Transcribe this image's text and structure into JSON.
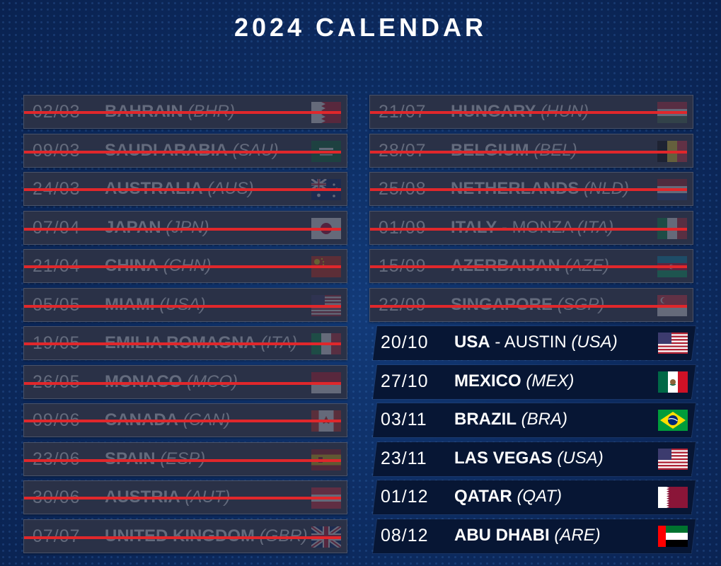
{
  "title": "2024 CALENDAR",
  "left_column": [
    {
      "date": "02/03",
      "country": "BAHRAIN",
      "circuit": "",
      "code": "(BHR)",
      "flag": "bahrain-flag",
      "status": "past"
    },
    {
      "date": "09/03",
      "country": "SAUDI ARABIA",
      "circuit": "",
      "code": "(SAU)",
      "flag": "saudi-arabia-flag",
      "status": "past"
    },
    {
      "date": "24/03",
      "country": "AUSTRALIA",
      "circuit": "",
      "code": "(AUS)",
      "flag": "australia-flag",
      "status": "past"
    },
    {
      "date": "07/04",
      "country": "JAPAN",
      "circuit": "",
      "code": "(JPN)",
      "flag": "japan-flag",
      "status": "past"
    },
    {
      "date": "21/04",
      "country": "CHINA",
      "circuit": "",
      "code": "(CHN)",
      "flag": "china-flag",
      "status": "past"
    },
    {
      "date": "05/05",
      "country": "MIAMI",
      "circuit": "",
      "code": "(USA)",
      "flag": "usa-flag",
      "status": "past"
    },
    {
      "date": "19/05",
      "country": "EMILIA ROMAGNA",
      "circuit": "",
      "code": "(ITA)",
      "flag": "italy-flag",
      "status": "past"
    },
    {
      "date": "26/05",
      "country": "MONACO",
      "circuit": "",
      "code": "(MCO)",
      "flag": "monaco-flag",
      "status": "past"
    },
    {
      "date": "09/06",
      "country": "CANADA",
      "circuit": "",
      "code": "(CAN)",
      "flag": "canada-flag",
      "status": "past"
    },
    {
      "date": "23/06",
      "country": "SPAIN",
      "circuit": "",
      "code": "(ESP)",
      "flag": "spain-flag",
      "status": "past"
    },
    {
      "date": "30/06",
      "country": "AUSTRIA",
      "circuit": "",
      "code": "(AUT)",
      "flag": "austria-flag",
      "status": "past"
    },
    {
      "date": "07/07",
      "country": "UNITED KINGDOM",
      "circuit": "",
      "code": "(GBR)",
      "flag": "uk-flag",
      "status": "past"
    }
  ],
  "right_column": [
    {
      "date": "21/07",
      "country": "HUNGARY",
      "circuit": "",
      "code": "(HUN)",
      "flag": "hungary-flag",
      "status": "past"
    },
    {
      "date": "28/07",
      "country": "BELGIUM",
      "circuit": "",
      "code": "(BEL)",
      "flag": "belgium-flag",
      "status": "past"
    },
    {
      "date": "25/08",
      "country": "NETHERLANDS",
      "circuit": "",
      "code": "(NLD)",
      "flag": "netherlands-flag",
      "status": "past"
    },
    {
      "date": "01/09",
      "country": "ITALY",
      "circuit": "- MONZA",
      "code": "(ITA)",
      "flag": "italy-flag",
      "status": "past"
    },
    {
      "date": "15/09",
      "country": "AZERBAIJAN",
      "circuit": "",
      "code": "(AZE)",
      "flag": "azerbaijan-flag",
      "status": "past"
    },
    {
      "date": "22/09",
      "country": "SINGAPORE",
      "circuit": "",
      "code": "(SGP)",
      "flag": "singapore-flag",
      "status": "past"
    },
    {
      "date": "20/10",
      "country": "USA",
      "circuit": "- AUSTIN",
      "code": "(USA)",
      "flag": "usa-flag",
      "status": "upcoming"
    },
    {
      "date": "27/10",
      "country": "MEXICO",
      "circuit": "",
      "code": "(MEX)",
      "flag": "mexico-flag",
      "status": "upcoming"
    },
    {
      "date": "03/11",
      "country": "BRAZIL",
      "circuit": "",
      "code": "(BRA)",
      "flag": "brazil-flag",
      "status": "upcoming"
    },
    {
      "date": "23/11",
      "country": "LAS VEGAS",
      "circuit": "",
      "code": "(USA)",
      "flag": "usa-flag",
      "status": "upcoming"
    },
    {
      "date": "01/12",
      "country": "QATAR",
      "circuit": "",
      "code": "(QAT)",
      "flag": "qatar-flag",
      "status": "upcoming"
    },
    {
      "date": "08/12",
      "country": "ABU DHABI",
      "circuit": "",
      "code": "(ARE)",
      "flag": "uae-flag",
      "status": "upcoming"
    }
  ]
}
